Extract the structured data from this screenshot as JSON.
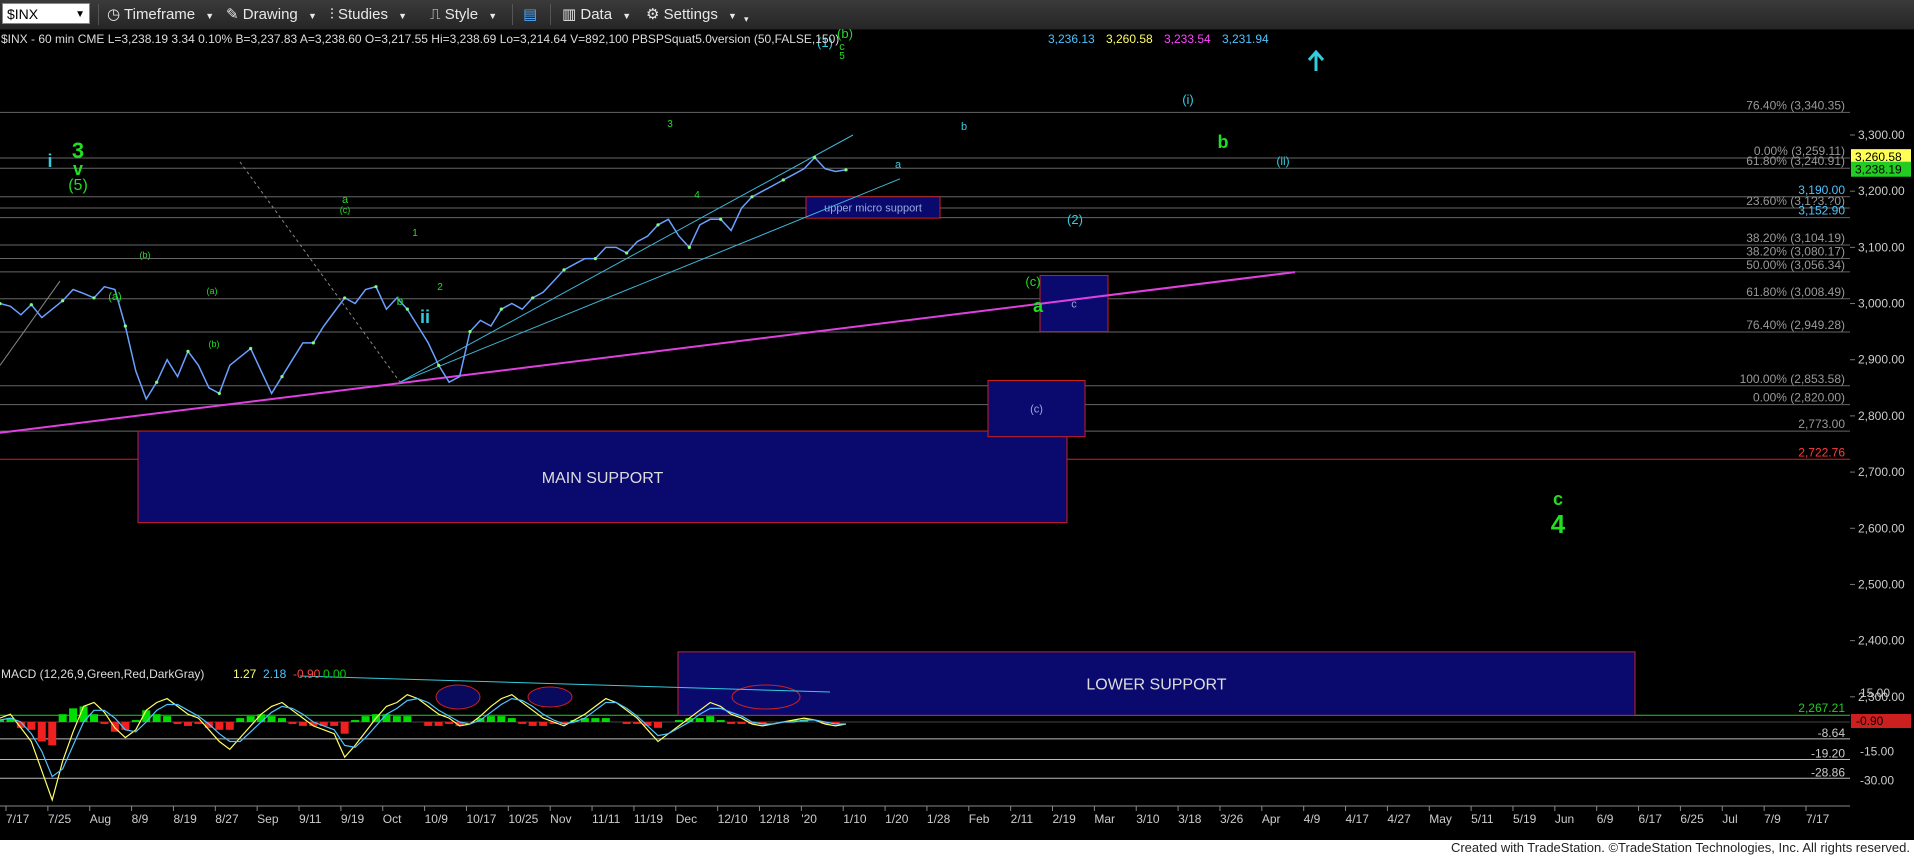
{
  "toolbar": {
    "symbol": "$INX",
    "timeframe_label": "Timeframe",
    "drawing_label": "Drawing",
    "studies_label": "Studies",
    "style_label": "Style",
    "data_label": "Data",
    "settings_label": "Settings"
  },
  "header": {
    "line": "$INX - 60 min  CME  L=3,238.19  3.34  0.10%  B=3,237.83  A=3,238.60  O=3,217.55  Hi=3,238.69  Lo=3,214.64  V=892,100  PBSPSquat5.0version (50,FALSE,150)",
    "study_values": [
      "3,236.13",
      "3,260.58",
      "3,233.54",
      "3,231.94"
    ],
    "study_colors": [
      "#4fc3ff",
      "#ffff66",
      "#ff44ff",
      "#4fc3ff"
    ]
  },
  "macd_header": {
    "label": "MACD (12,26,9,Green,Red,DarkGray)",
    "values": [
      "1.27",
      "2.18",
      "-0.90",
      "0.00"
    ],
    "colors": [
      "#ffff66",
      "#4fc3ff",
      "#ff4444",
      "#00cc00"
    ]
  },
  "footer": "Created with TradeStation. ©TradeStation Technologies, Inc. All rights reserved.",
  "colors": {
    "background": "#000000",
    "price_line": "#6aa0ff",
    "support_box": "#0a0a6e",
    "support_border": "#cc2020",
    "trendline": "#e040e0",
    "channel": "#3fb6d8",
    "wave_green": "#22dd22",
    "wave_cyan": "#33ccdd",
    "fib_text": "#888888"
  },
  "chart_data": {
    "type": "line",
    "title": "$INX - 60 min",
    "xlabel": "",
    "ylabel": "",
    "ylim": [
      2230,
      3380
    ],
    "x_tick_labels": [
      "7/17",
      "7/25",
      "Aug",
      "8/9",
      "8/19",
      "8/27",
      "Sep",
      "9/11",
      "9/19",
      "Oct",
      "10/9",
      "10/17",
      "10/25",
      "Nov",
      "11/11",
      "11/19",
      "Dec",
      "12/10",
      "12/18",
      "'20",
      "1/10",
      "1/20",
      "1/28",
      "Feb",
      "2/11",
      "2/19",
      "Mar",
      "3/10",
      "3/18",
      "3/26",
      "Apr",
      "4/9",
      "4/17",
      "4/27",
      "May",
      "5/11",
      "5/19",
      "Jun",
      "6/9",
      "6/17",
      "6/25",
      "Jul",
      "7/9",
      "7/17"
    ],
    "y_ticks": [
      2300,
      2400,
      2500,
      2600,
      2700,
      2800,
      2900,
      3000,
      3100,
      3200,
      3300
    ],
    "y_tick_labels": [
      "2,300.00",
      "2,400.00",
      "2,500.00",
      "2,600.00",
      "2,700.00",
      "2,800.00",
      "2,900.00",
      "3,000.00",
      "3,100.00",
      "3,200.00",
      "3,300.00"
    ],
    "series": [
      {
        "values": [
          3000,
          2995,
          2980,
          2998,
          2975,
          2990,
          3005,
          3025,
          3018,
          3010,
          3030,
          3025,
          2960,
          2880,
          2830,
          2860,
          2900,
          2870,
          2915,
          2890,
          2850,
          2840,
          2890,
          2905,
          2920,
          2880,
          2840,
          2870,
          2900,
          2930,
          2930,
          2960,
          2985,
          3010,
          3000,
          3025,
          3030,
          2990,
          3010,
          2990,
          2960,
          2930,
          2890,
          2860,
          2870,
          2950,
          2970,
          2960,
          2990,
          3000,
          2990,
          3010,
          3020,
          3040,
          3060,
          3070,
          3080,
          3080,
          3100,
          3100,
          3090,
          3110,
          3120,
          3140,
          3150,
          3120,
          3100,
          3140,
          3150,
          3150,
          3130,
          3170,
          3190,
          3200,
          3210,
          3220,
          3230,
          3240,
          3260,
          3240,
          3235,
          3238
        ]
      }
    ],
    "price_axis_labels": [
      {
        "label": "3,260.58",
        "color": "#ffff66"
      },
      {
        "label": "3,238.19",
        "color": "#22cc22"
      }
    ],
    "fib_levels": [
      {
        "label": "76.40% (3,340.35)",
        "value": 3340.35
      },
      {
        "label": "0.00% (3,259.11)",
        "value": 3259.11
      },
      {
        "label": "61.80% (3,240.91)",
        "value": 3240.91
      },
      {
        "label": "3,190.00",
        "value": 3190
      },
      {
        "label": "23.60% (3,1?3.?0)",
        "value": 3170
      },
      {
        "label": "3,152.90",
        "value": 3152.9
      },
      {
        "label": "38.20% (3,104.19)",
        "value": 3104.19
      },
      {
        "label": "38.20% (3,080.17)",
        "value": 3080.17
      },
      {
        "label": "50.00% (3,056.34)",
        "value": 3056.34
      },
      {
        "label": "61.80% (3,008.49)",
        "value": 3008.49
      },
      {
        "label": "76.40% (2,949.28)",
        "value": 2949.28
      },
      {
        "label": "100.00% (2,853.58)",
        "value": 2853.58
      },
      {
        "label": "0.00% (2,820.00)",
        "value": 2820
      },
      {
        "label": "2,773.00",
        "value": 2773
      },
      {
        "label": "2,722.76",
        "value": 2722.76
      },
      {
        "label": "2,267.21",
        "value": 2267.21
      }
    ],
    "boxes": [
      {
        "label": "MAIN SUPPORT",
        "top": 2773,
        "bottom": 2610
      },
      {
        "label": "LOWER SUPPORT",
        "top": 2380,
        "bottom": 2267
      },
      {
        "label": "upper micro support",
        "top": 3190,
        "bottom": 3152
      },
      {
        "label": "c",
        "top": 3050,
        "bottom": 2950
      },
      {
        "label": "(c)",
        "top": 2863,
        "bottom": 2763
      }
    ],
    "wave_labels": [
      "i",
      "3",
      "v",
      "(5)",
      "(a)",
      "(b)",
      "(a)",
      "(b)",
      "a",
      "(c)",
      "b",
      "ii",
      "1",
      "2",
      "3",
      "4",
      "(1)",
      "(b)",
      "c",
      "5",
      "(i)",
      "(ii)",
      "a",
      "b",
      "b",
      "(2)",
      "(c)",
      "a",
      "c",
      "4"
    ],
    "macd": {
      "y_tick_labels": [
        "15.00",
        "-15.00",
        "-30.00"
      ],
      "levels": [
        "-8.64",
        "-19.20",
        "-28.86"
      ],
      "current_value": "-0.90",
      "macd_values": [
        2,
        4,
        -3,
        -10,
        -25,
        -40,
        -20,
        -5,
        8,
        10,
        5,
        -3,
        -8,
        -4,
        6,
        10,
        12,
        8,
        4,
        2,
        -4,
        -10,
        -14,
        -8,
        -2,
        4,
        8,
        10,
        6,
        2,
        -2,
        -4,
        -6,
        -18,
        -12,
        -5,
        2,
        8,
        10,
        14,
        12,
        8,
        4,
        2,
        -2,
        -1,
        3,
        8,
        12,
        14,
        10,
        6,
        2,
        0,
        -2,
        1,
        4,
        8,
        12,
        10,
        6,
        2,
        -4,
        -10,
        -6,
        -2,
        2,
        6,
        10,
        8,
        4,
        2,
        -1,
        -2,
        -1,
        0,
        1,
        2,
        1,
        -1,
        -2,
        -1
      ],
      "signal_values": [
        1,
        2,
        0,
        -6,
        -15,
        -28,
        -24,
        -12,
        0,
        6,
        6,
        2,
        -4,
        -5,
        0,
        6,
        9,
        9,
        6,
        3,
        -1,
        -6,
        -10,
        -10,
        -5,
        0,
        5,
        8,
        7,
        4,
        0,
        -2,
        -4,
        -12,
        -13,
        -8,
        -2,
        4,
        7,
        11,
        12,
        10,
        6,
        3,
        0,
        -1,
        1,
        5,
        9,
        12,
        11,
        8,
        4,
        1,
        -1,
        0,
        2,
        6,
        10,
        10,
        7,
        3,
        -2,
        -7,
        -6,
        -3,
        0,
        4,
        7,
        7,
        5,
        3,
        0,
        -1,
        -1,
        0,
        0,
        1,
        1,
        0,
        -1,
        -1
      ]
    }
  }
}
